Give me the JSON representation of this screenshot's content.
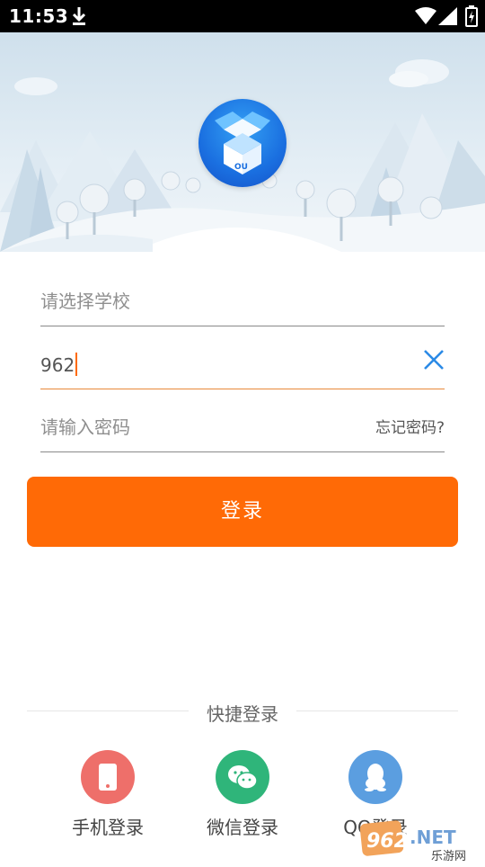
{
  "status_bar": {
    "time": "11:53"
  },
  "form": {
    "school_placeholder": "请选择学校",
    "account_value": "962",
    "password_placeholder": "请输入密码",
    "forgot_label": "忘记密码?",
    "login_label": "登录"
  },
  "quick_login": {
    "title": "快捷登录",
    "items": [
      {
        "label": "手机登录",
        "icon": "phone-icon",
        "color": "#ee6f6a"
      },
      {
        "label": "微信登录",
        "icon": "wechat-icon",
        "color": "#2fb57a"
      },
      {
        "label": "QQ登录",
        "icon": "qq-icon",
        "color": "#5b9ee0"
      }
    ]
  },
  "watermark": {
    "brand": "962.NET",
    "sub": "乐游网"
  },
  "colors": {
    "accent": "#ff6a06",
    "active_underline": "#e8893b",
    "clear_icon": "#2b8ae6"
  }
}
